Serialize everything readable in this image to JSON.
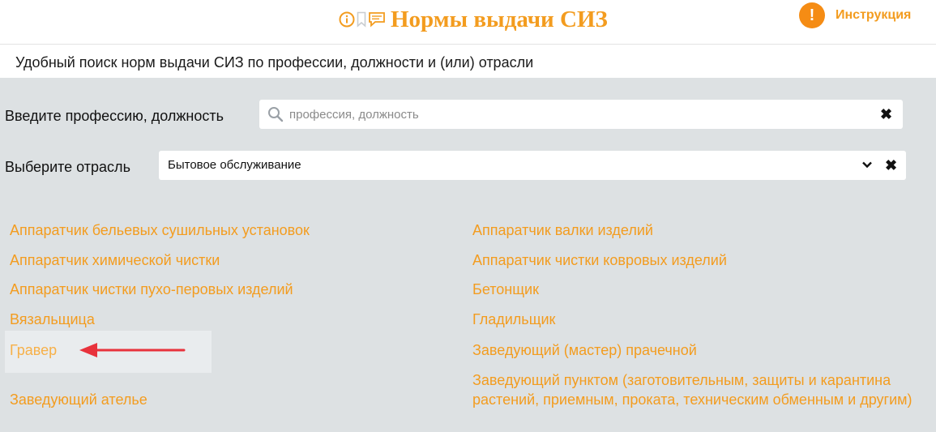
{
  "header": {
    "title": "Нормы выдачи СИЗ",
    "icons": [
      "info-icon",
      "bookmark-icon",
      "comment-icon"
    ],
    "instruction_badge": "!",
    "instruction_label": "Инструкция"
  },
  "subtitle": "Удобный поиск норм выдачи СИЗ по профессии, должности и (или) отрасли",
  "form": {
    "profession_label": "Введите профессию, должность",
    "profession_placeholder": "профессия, должность",
    "profession_value": "",
    "industry_label": "Выберите отрасль",
    "industry_value": "Бытовое обслуживание"
  },
  "professions": {
    "left": [
      "Аппаратчик бельевых сушильных установок",
      "Аппаратчик химической чистки",
      "Аппаратчик чистки пухо-перовых изделий",
      "Вязальщица",
      "Гравер",
      "Заведующий ателье"
    ],
    "right": [
      "Аппаратчик валки изделий",
      "Аппаратчик чистки ковровых изделий",
      "Бетонщик",
      "Гладильщик",
      "Заведующий (мастер) прачечной",
      "Заведующий пунктом (заготовительным, защиты и карантина растений, приемным, проката, техническим обменным и другим)"
    ]
  },
  "colors": {
    "accent": "#f39c1f",
    "badge": "#f58c14",
    "panel_bg": "#dde1e3",
    "arrow": "#e8323c"
  }
}
